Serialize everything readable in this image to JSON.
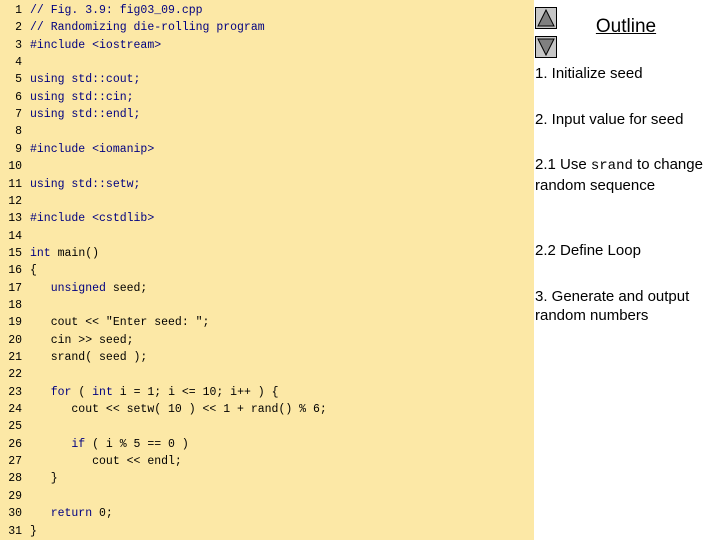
{
  "code_lines": [
    {
      "num": "1",
      "parts": [
        {
          "t": "// Fig. 3.9: fig03_09.cpp",
          "c": "comment"
        }
      ]
    },
    {
      "num": "2",
      "parts": [
        {
          "t": "// Randomizing die-rolling program",
          "c": "comment"
        }
      ]
    },
    {
      "num": "3",
      "parts": [
        {
          "t": "#include <iostream>",
          "c": "kw"
        }
      ]
    },
    {
      "num": "4",
      "parts": []
    },
    {
      "num": "5",
      "parts": [
        {
          "t": "using std::cout;",
          "c": "kw"
        }
      ]
    },
    {
      "num": "6",
      "parts": [
        {
          "t": "using std::cin;",
          "c": "kw"
        }
      ]
    },
    {
      "num": "7",
      "parts": [
        {
          "t": "using std::endl;",
          "c": "kw"
        }
      ]
    },
    {
      "num": "8",
      "parts": []
    },
    {
      "num": "9",
      "parts": [
        {
          "t": "#include <iomanip>",
          "c": "kw"
        }
      ]
    },
    {
      "num": "10",
      "parts": []
    },
    {
      "num": "11",
      "parts": [
        {
          "t": "using std::setw;",
          "c": "kw"
        }
      ]
    },
    {
      "num": "12",
      "parts": []
    },
    {
      "num": "13",
      "parts": [
        {
          "t": "#include <cstdlib>",
          "c": "kw"
        }
      ]
    },
    {
      "num": "14",
      "parts": []
    },
    {
      "num": "15",
      "parts": [
        {
          "t": "int",
          "c": "kw"
        },
        {
          "t": " main()",
          "c": "plain"
        }
      ]
    },
    {
      "num": "16",
      "parts": [
        {
          "t": "{",
          "c": "plain"
        }
      ]
    },
    {
      "num": "17",
      "parts": [
        {
          "t": "   unsigned",
          "c": "kw"
        },
        {
          "t": " seed;",
          "c": "plain"
        }
      ]
    },
    {
      "num": "18",
      "parts": []
    },
    {
      "num": "19",
      "parts": [
        {
          "t": "   cout << \"Enter seed: \";",
          "c": "plain"
        }
      ]
    },
    {
      "num": "20",
      "parts": [
        {
          "t": "   cin >> seed;",
          "c": "plain"
        }
      ]
    },
    {
      "num": "21",
      "parts": [
        {
          "t": "   srand( seed );",
          "c": "plain"
        }
      ]
    },
    {
      "num": "22",
      "parts": []
    },
    {
      "num": "23",
      "parts": [
        {
          "t": "   for",
          "c": "kw"
        },
        {
          "t": " ( ",
          "c": "plain"
        },
        {
          "t": "int",
          "c": "kw"
        },
        {
          "t": " i = 1; i <= 10; i++ ) {",
          "c": "plain"
        }
      ]
    },
    {
      "num": "24",
      "parts": [
        {
          "t": "      cout << setw( 10 ) << 1 + rand() % 6;",
          "c": "plain"
        }
      ]
    },
    {
      "num": "25",
      "parts": []
    },
    {
      "num": "26",
      "parts": [
        {
          "t": "      if",
          "c": "kw"
        },
        {
          "t": " ( i % 5 == 0 )",
          "c": "plain"
        }
      ]
    },
    {
      "num": "27",
      "parts": [
        {
          "t": "         cout << endl;",
          "c": "plain"
        }
      ]
    },
    {
      "num": "28",
      "parts": [
        {
          "t": "   }",
          "c": "plain"
        }
      ]
    },
    {
      "num": "29",
      "parts": []
    },
    {
      "num": "30",
      "parts": [
        {
          "t": "   return",
          "c": "kw"
        },
        {
          "t": " 0;",
          "c": "plain"
        }
      ]
    },
    {
      "num": "31",
      "parts": [
        {
          "t": "}",
          "c": "plain"
        }
      ]
    }
  ],
  "colors": {
    "code_background": "#fce8a6",
    "comment": "#000080",
    "keyword": "#000080",
    "nav_button": "#c6c6c6"
  },
  "nav": {
    "up_icon": "triangle-up-icon",
    "down_icon": "triangle-down-icon"
  },
  "outline": {
    "title": "Outline",
    "item1": "1.  Initialize seed",
    "item2": "2.  Input value for seed",
    "item3_pre": "2.1  Use ",
    "item3_code": "srand",
    "item3_post": " to change random sequence",
    "item4": "2.2  Define Loop",
    "item5": "3.  Generate and output random numbers"
  }
}
